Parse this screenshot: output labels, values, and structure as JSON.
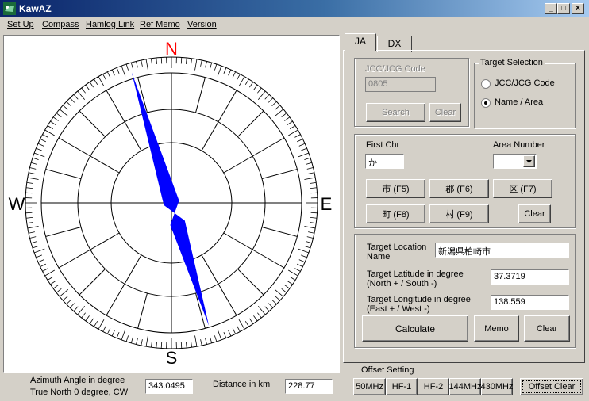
{
  "window": {
    "title": "KawAZ",
    "minimize": "_",
    "maximize": "□",
    "close": "×"
  },
  "menu": [
    "Set Up",
    "Compass",
    "Hamlog Link",
    "Ref Memo",
    "Version"
  ],
  "compass": {
    "labels": {
      "north": "N",
      "south": "S",
      "east": "E",
      "west": "W"
    },
    "needle_azimuth_deg": 343.0495,
    "needle_color": "#0000ff",
    "north_label_color": "#ff0000"
  },
  "bottom": {
    "azimuth_label_line1": "Azimuth Angle in degree",
    "azimuth_label_line2": "True North 0 degree, CW",
    "azimuth_value": "343.0495",
    "distance_label": "Distance in km",
    "distance_value": "228.77"
  },
  "tabs": {
    "ja": "JA",
    "dx": "DX",
    "active": "JA"
  },
  "jcc": {
    "label": "JCC/JCG Code",
    "value": "0805",
    "search_label": "Search",
    "clear_label": "Clear"
  },
  "target_selection": {
    "title": "Target Selection",
    "option_jcc": "JCC/JCG Code",
    "option_name": "Name / Area",
    "selected": "Name / Area"
  },
  "chr": {
    "first_chr_label": "First Chr",
    "first_chr_value": "か",
    "area_number_label": "Area Number",
    "area_number_value": "",
    "buttons": [
      "市 (F5)",
      "郡 (F6)",
      "区 (F7)",
      "町 (F8)",
      "村 (F9)"
    ],
    "clear_label": "Clear"
  },
  "target": {
    "location_label_1": "Target Location",
    "location_label_2": "Name",
    "location_value": "新潟県柏崎市",
    "lat_label_1": "Target Latitude in degree",
    "lat_label_2": "(North + / South -)",
    "lat_value": "37.3719",
    "lon_label_1": "Target Longitude in degree",
    "lon_label_2": "(East + / West -)",
    "lon_value": "138.559",
    "calculate_label": "Calculate",
    "memo_label": "Memo",
    "clear_label": "Clear"
  },
  "offset": {
    "title": "Offset Setting",
    "buttons": [
      "50MHz",
      "HF-1",
      "HF-2",
      "144MHz",
      "430MHz"
    ],
    "clear_label": "Offset Clear"
  }
}
